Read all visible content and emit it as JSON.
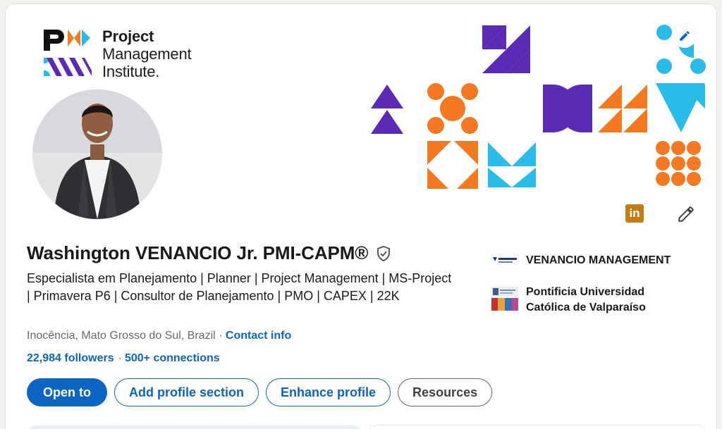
{
  "banner": {
    "org_line1": "Project",
    "org_line2": "Management",
    "org_line3": "Institute."
  },
  "profile": {
    "name": "Washington VENANCIO Jr. PMI-CAPM®",
    "headline": "Especialista em Planejamento | Planner | Project Management | MS-Project | Primavera P6 | Consultor de Planejamento | PMO | CAPEX | 22K",
    "location": "Inocência, Mato Grosso do Sul, Brazil",
    "location_sep": " · ",
    "contact_info": "Contact info",
    "followers": "22,984 followers",
    "network_sep": "·",
    "connections": "500+ connections",
    "linkedin_badge": "in"
  },
  "actions": {
    "open_to": "Open to",
    "add_section": "Add profile section",
    "enhance": "Enhance profile",
    "resources": "Resources"
  },
  "experience": [
    {
      "label": "VENANCIO MANAGEMENT",
      "icon": "venancio-logo"
    },
    {
      "label": "Pontificia Universidad Católica de Valparaíso",
      "icon": "pucv-logo"
    }
  ],
  "colors": {
    "accent": "#0a66c2",
    "purple": "#5b2bb5",
    "orange": "#f47920",
    "cyan": "#27bde8",
    "linkedin_badge": "#c37d16"
  }
}
